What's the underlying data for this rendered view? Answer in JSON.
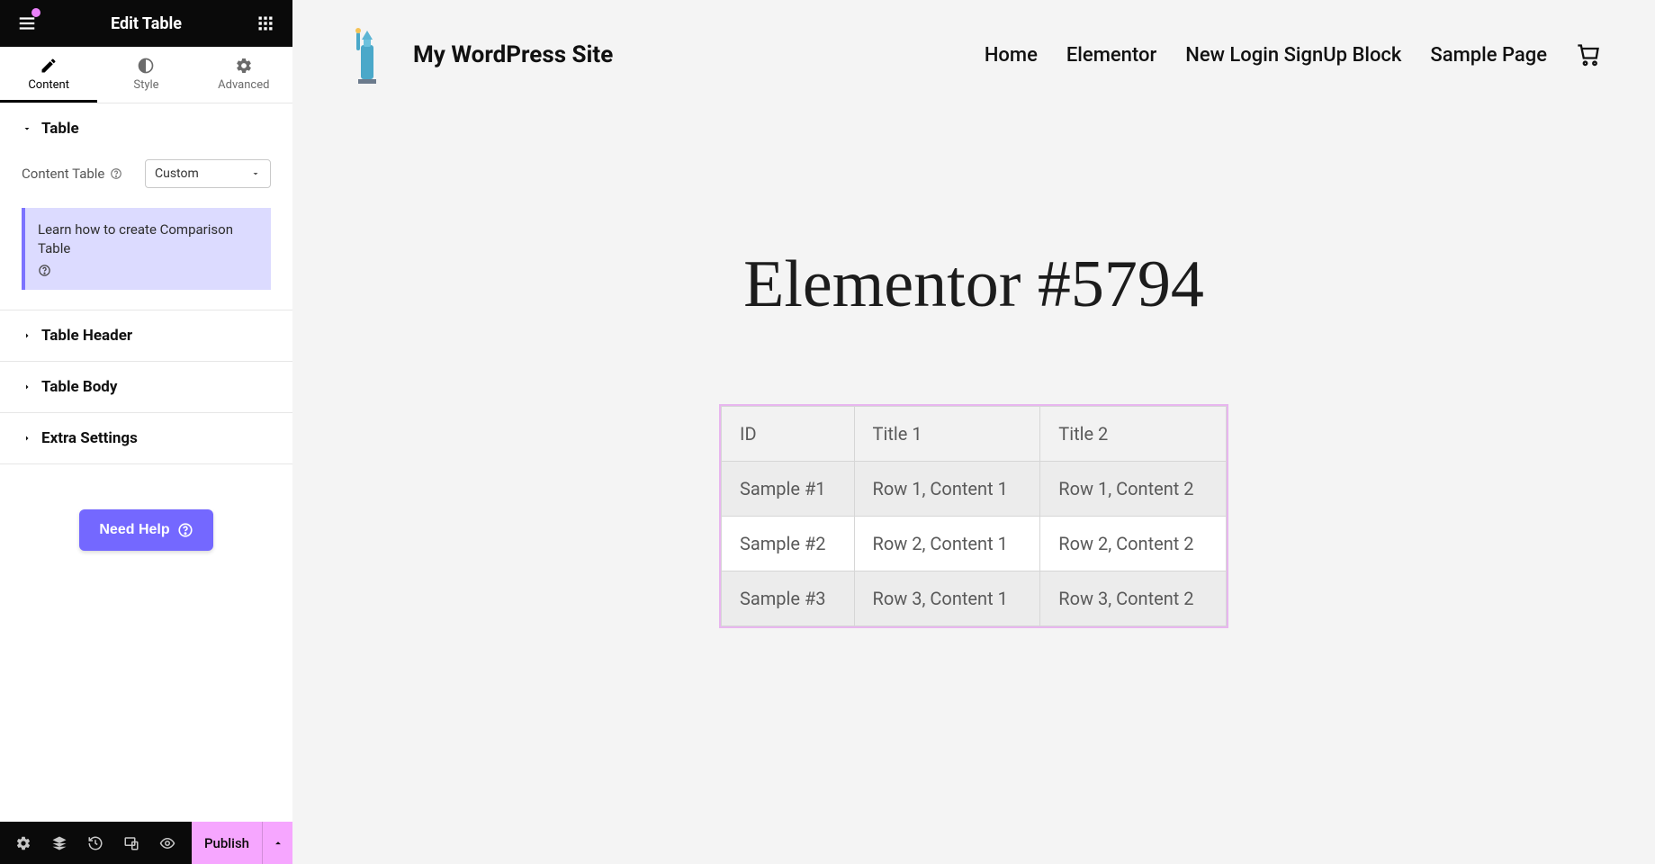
{
  "editor": {
    "title": "Edit Table",
    "tabs": {
      "content": "Content",
      "style": "Style",
      "advanced": "Advanced"
    },
    "sections": {
      "table": {
        "label": "Table",
        "open": true
      },
      "header": {
        "label": "Table Header",
        "open": false
      },
      "body": {
        "label": "Table Body",
        "open": false
      },
      "extra": {
        "label": "Extra Settings",
        "open": false
      }
    },
    "content_table_label": "Content Table",
    "content_table_value": "Custom",
    "info_text": "Learn how to create Comparison Table",
    "need_help": "Need Help",
    "footer": {
      "publish": "Publish"
    }
  },
  "site": {
    "name": "My WordPress Site",
    "nav": [
      "Home",
      "Elementor",
      "New Login SignUp Block",
      "Sample Page"
    ],
    "page_title": "Elementor #5794",
    "table": {
      "headers": [
        "ID",
        "Title 1",
        "Title 2"
      ],
      "rows": [
        [
          "Sample #1",
          "Row 1, Content 1",
          "Row 1, Content 2"
        ],
        [
          "Sample #2",
          "Row 2, Content 1",
          "Row 2, Content 2"
        ],
        [
          "Sample #3",
          "Row 3, Content 1",
          "Row 3, Content 2"
        ]
      ]
    }
  }
}
